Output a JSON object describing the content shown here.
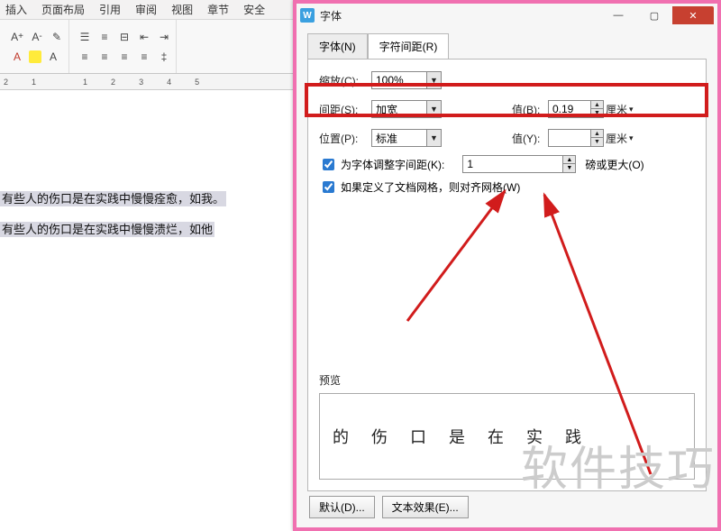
{
  "menu": {
    "items": [
      "插入",
      "页面布局",
      "引用",
      "审阅",
      "视图",
      "章节",
      "安全"
    ]
  },
  "ruler": {
    "ticks": [
      "2",
      "",
      "1",
      "",
      "",
      "",
      "1",
      "2",
      "3",
      "4",
      "5"
    ]
  },
  "doc": {
    "line1": "有些人的伤口是在实践中慢慢痊愈，如我。",
    "line2": "有些人的伤口是在实践中慢慢溃烂，如他"
  },
  "dialog": {
    "title": "字体",
    "tabs": {
      "font": "字体(N)",
      "spacing": "字符间距(R)"
    },
    "scale": {
      "label": "缩放(C):",
      "value": "100%"
    },
    "spacing": {
      "label": "间距(S):",
      "value": "加宽"
    },
    "spacing_val": {
      "label": "值(B):",
      "value": "0.19",
      "unit": "厘米"
    },
    "position": {
      "label": "位置(P):",
      "value": "标准"
    },
    "position_val": {
      "label": "值(Y):",
      "value": "",
      "unit": "厘米"
    },
    "kerning": {
      "label": "为字体调整字间距(K):",
      "value": "1",
      "suffix": "磅或更大(O)"
    },
    "snapgrid": {
      "label": "如果定义了文档网格，则对齐网格(W)"
    },
    "preview_label": "预览",
    "preview_text": "的 伤 口 是 在 实 践",
    "buttons": {
      "default": "默认(D)...",
      "effects": "文本效果(E)..."
    }
  },
  "watermark": "软件技巧"
}
